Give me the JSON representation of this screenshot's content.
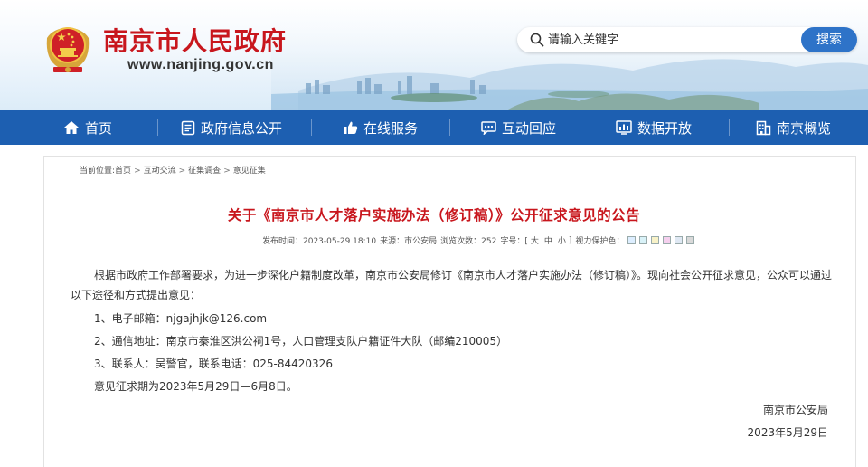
{
  "header": {
    "site_title": "南京市人民政府",
    "site_url": "www.nanjing.gov.cn",
    "search_placeholder": "请输入关键字",
    "search_button": "搜索"
  },
  "nav": {
    "items": [
      {
        "label": "首页",
        "icon": "home-icon"
      },
      {
        "label": "政府信息公开",
        "icon": "document-icon"
      },
      {
        "label": "在线服务",
        "icon": "thumbs-up-icon"
      },
      {
        "label": "互动回应",
        "icon": "chat-icon"
      },
      {
        "label": "数据开放",
        "icon": "chart-icon"
      },
      {
        "label": "南京概览",
        "icon": "building-icon"
      }
    ]
  },
  "breadcrumb": {
    "prefix": "当前位置:",
    "items": [
      "首页",
      "互动交流",
      "征集调查",
      "意见征集"
    ]
  },
  "article": {
    "title": "关于《南京市人才落户实施办法（修订稿）》公开征求意见的公告",
    "meta": {
      "publish_time": "发布时间：2023-05-29 18:10",
      "source": "来源：市公安局",
      "views": "浏览次数：252",
      "font_size_label": "字号：[",
      "size_large": "大",
      "size_medium": "中",
      "size_small": "小",
      "font_size_end": "]",
      "eye_care_label": "视力保护色："
    },
    "paragraph": "根据市政府工作部署要求，为进一步深化户籍制度改革，南京市公安局修订《南京市人才落户实施办法（修订稿）》。现向社会公开征求意见，公众可以通过以下途径和方式提出意见：",
    "line1": "1、电子邮箱：njgajhjk@126.com",
    "line2": "2、通信地址：南京市秦淮区洪公祠1号，人口管理支队户籍证件大队（邮编210005）",
    "line3": "3、联系人：吴警官，联系电话：025-84420326",
    "period": "意见征求期为2023年5月29日—6月8日。",
    "signature_org": "南京市公安局",
    "signature_date": "2023年5月29日"
  },
  "colors": {
    "brand_red": "#c8161d",
    "nav_blue": "#1d5fb1",
    "search_button_blue": "#2e73c8",
    "eye_care_swatches": [
      "#ddeeff",
      "#d9f2f8",
      "#f8f2c8",
      "#f5d0ee",
      "#dfe8f3",
      "#d9d9d9"
    ]
  }
}
